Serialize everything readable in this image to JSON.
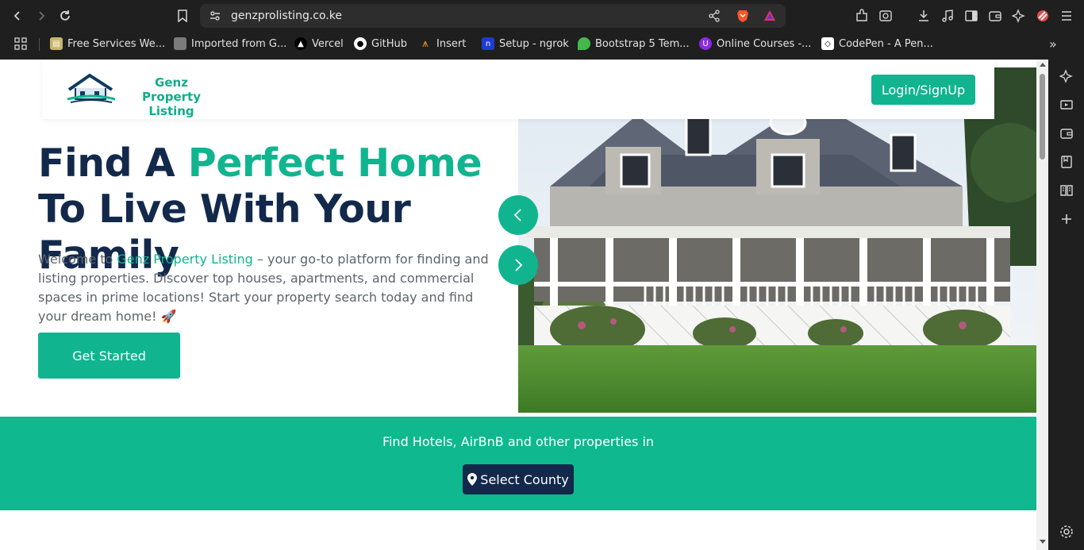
{
  "browser": {
    "url": "genzprolisting.co.ke",
    "bookmarks": [
      {
        "label": "Free Services We...",
        "icon": "folder-icon"
      },
      {
        "label": "Imported from G...",
        "icon": "folder-icon"
      },
      {
        "label": "Vercel",
        "icon": "vercel-icon"
      },
      {
        "label": "GitHub",
        "icon": "github-icon"
      },
      {
        "label": "Insert",
        "icon": "insert-icon"
      },
      {
        "label": "Setup - ngrok",
        "icon": "ngrok-icon"
      },
      {
        "label": "Bootstrap 5 Tem...",
        "icon": "bootstrap-icon"
      },
      {
        "label": "Online Courses -...",
        "icon": "udemy-icon"
      },
      {
        "label": "CodePen - A Pen...",
        "icon": "codepen-icon"
      }
    ]
  },
  "site": {
    "brand": "Genz Property Listing",
    "login_label": "Login/SignUp",
    "headline_prefix": "Find A ",
    "headline_accent": "Perfect Home",
    "headline_suffix": " To Live With Your Family",
    "intro_prefix": "Welcome to ",
    "intro_link": "Genz Property Listing",
    "intro_rest": " – your go-to platform for finding and listing properties. Discover top houses, apartments, and commercial spaces in prime locations! Start your property search today and find your dream home! 🚀",
    "cta_label": "Get Started",
    "band_text": "Find Hotels, AirBnB and other properties in",
    "county_label": "Select County"
  },
  "colors": {
    "accent": "#10b58f",
    "navy": "#13294b"
  }
}
